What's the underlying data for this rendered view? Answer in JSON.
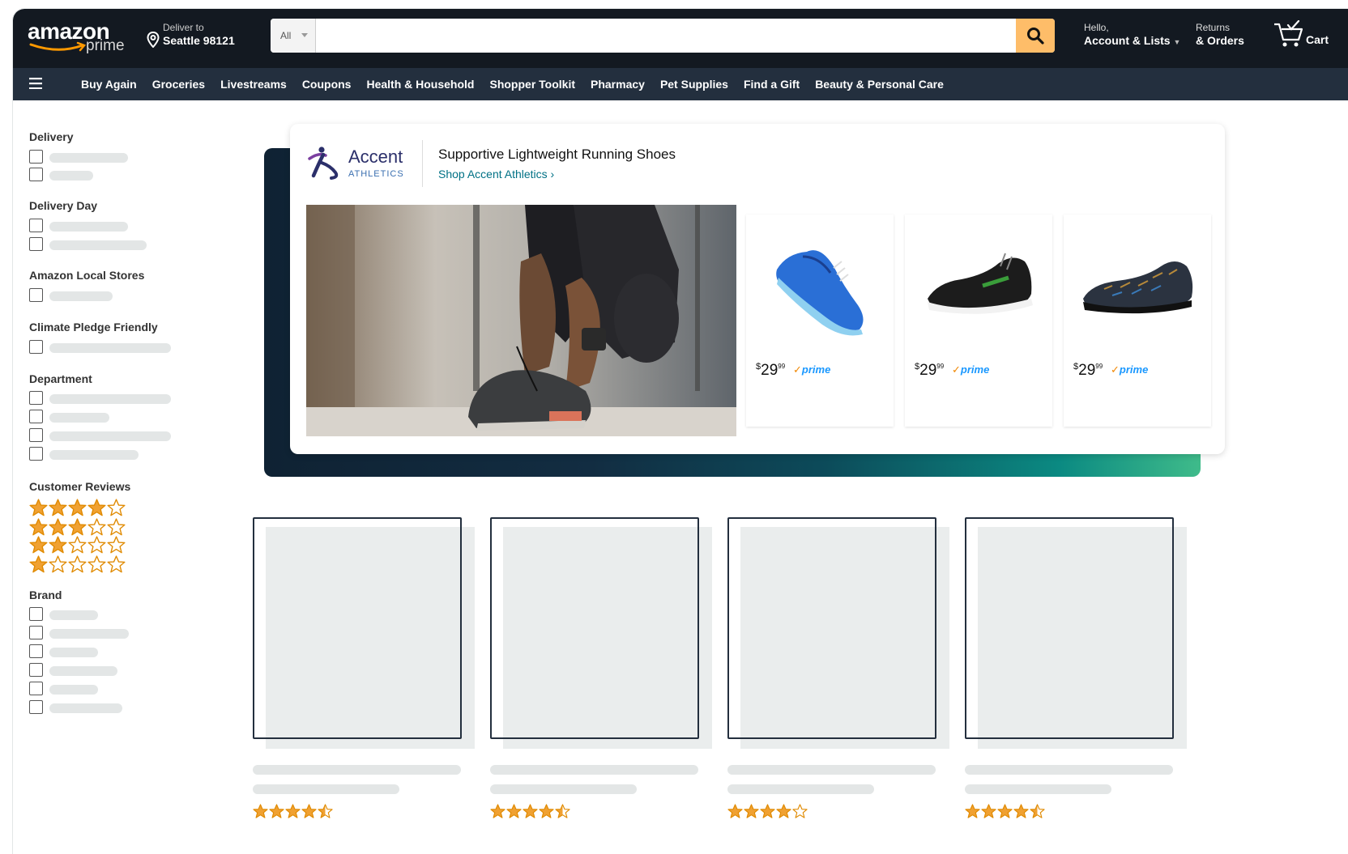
{
  "header": {
    "logo_text": "amazon",
    "logo_sub": "prime",
    "deliver_line1": "Deliver to",
    "deliver_line2": "Seattle 98121",
    "search_category": "All",
    "search_placeholder": "",
    "account_line1": "Hello,",
    "account_line2": "Account & Lists",
    "returns_line1": "Returns",
    "returns_line2": "& Orders",
    "cart_label": "Cart"
  },
  "nav": {
    "items": [
      "Buy Again",
      "Groceries",
      "Livestreams",
      "Coupons",
      "Health & Household",
      "Shopper Toolkit",
      "Pharmacy",
      "Pet Supplies",
      "Find a Gift",
      "Beauty & Personal Care"
    ]
  },
  "sidebar": {
    "sections": [
      "Delivery",
      "Delivery Day",
      "Amazon Local Stores",
      "Climate Pledge Friendly",
      "Department",
      "Customer Reviews",
      "Brand"
    ],
    "review_ratings": [
      4,
      3,
      2,
      1
    ]
  },
  "banner": {
    "brand_name": "Accent",
    "brand_sub": "ATHLETICS",
    "title": "Supportive Lightweight Running Shoes",
    "link": "Shop Accent Athletics ›",
    "products": [
      {
        "currency": "$",
        "whole": "29",
        "cents": "99",
        "badge": "prime",
        "color": "#2a6fd6"
      },
      {
        "currency": "$",
        "whole": "29",
        "cents": "99",
        "badge": "prime",
        "color": "#1c1c1c"
      },
      {
        "currency": "$",
        "whole": "29",
        "cents": "99",
        "badge": "prime",
        "color": "#2b3340"
      }
    ]
  },
  "results": {
    "tile_ratings": [
      4.5,
      4.5,
      4,
      4.5
    ]
  },
  "colors": {
    "header_bg": "#131921",
    "nav_bg": "#232f3e",
    "search_button": "#febd69",
    "link": "#007185",
    "star": "#f0a132"
  }
}
